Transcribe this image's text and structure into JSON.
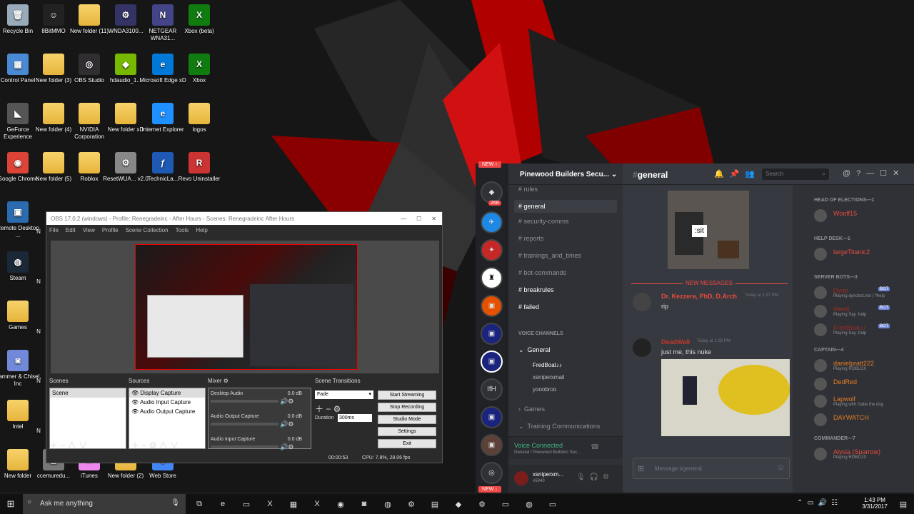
{
  "desktop": {
    "icons": [
      {
        "label": "Recycle Bin",
        "glyph": "🗑",
        "color": "#9ab"
      },
      {
        "label": "8BitMMO",
        "glyph": "☺",
        "color": "#222"
      },
      {
        "label": "New folder (11)",
        "glyph": "",
        "color": "folder"
      },
      {
        "label": "WNDA3100...",
        "glyph": "⚙",
        "color": "#336"
      },
      {
        "label": "NETGEAR WNA31...",
        "glyph": "N",
        "color": "#448"
      },
      {
        "label": "Xbox (beta)",
        "glyph": "X",
        "color": "#107c10"
      },
      {
        "label": "Control Panel",
        "glyph": "▦",
        "color": "#4a8ad4"
      },
      {
        "label": "New folder (3)",
        "glyph": "",
        "color": "folder"
      },
      {
        "label": "OBS Studio",
        "glyph": "◎",
        "color": "#302e31"
      },
      {
        "label": "hdaudio_1...",
        "glyph": "◆",
        "color": "#76b900"
      },
      {
        "label": "Microsoft Edge xD",
        "glyph": "e",
        "color": "#0078d7"
      },
      {
        "label": "Xbox",
        "glyph": "X",
        "color": "#107c10"
      },
      {
        "label": "GeForce Experience",
        "glyph": "◣",
        "color": "#555"
      },
      {
        "label": "New folder (4)",
        "glyph": "",
        "color": "folder"
      },
      {
        "label": "NVIDIA Corporation",
        "glyph": "",
        "color": "folder"
      },
      {
        "label": "New folder xD",
        "glyph": "",
        "color": "folder"
      },
      {
        "label": "Internet Explorer",
        "glyph": "e",
        "color": "#1e90ff"
      },
      {
        "label": "logos",
        "glyph": "",
        "color": "folder"
      },
      {
        "label": "Google Chrome",
        "glyph": "◉",
        "color": "#db4437"
      },
      {
        "label": "New folder (5)",
        "glyph": "",
        "color": "folder"
      },
      {
        "label": "Roblox",
        "glyph": "",
        "color": "folder"
      },
      {
        "label": "ResetWUA... v2.0",
        "glyph": "⚙",
        "color": "#888"
      },
      {
        "label": "TechnicLa...",
        "glyph": "ƒ",
        "color": "#1e5ab4"
      },
      {
        "label": "Revo Uninstaller",
        "glyph": "R",
        "color": "#c33"
      },
      {
        "label": "Remote Desktop ...",
        "glyph": "▣",
        "color": "#2b6cb0"
      },
      {
        "label": "Steam",
        "glyph": "◍",
        "color": "#1b2838"
      },
      {
        "label": "Games",
        "glyph": "",
        "color": "folder"
      },
      {
        "label": "Hammer & Chisel, Inc",
        "glyph": "◙",
        "color": "#7289da"
      },
      {
        "label": "Intel",
        "glyph": "",
        "color": "folder"
      },
      {
        "label": "New folder",
        "glyph": "",
        "color": "folder"
      },
      {
        "label": "ccemuredu...",
        "glyph": "▢",
        "color": "#777"
      },
      {
        "label": "iTunes",
        "glyph": "♫",
        "color": "#e8e"
      },
      {
        "label": "New folder (2)",
        "glyph": "",
        "color": "folder"
      },
      {
        "label": "Web Store",
        "glyph": "◈",
        "color": "#4285f4"
      }
    ],
    "partial_labels": [
      "N",
      "N",
      "N",
      "N",
      "N"
    ]
  },
  "obs": {
    "title": "OBS 17.0.2 (windows) - Profile: Renegradeinc - After Hours - Scenes: Renegradeinc After Hours",
    "menu": [
      "File",
      "Edit",
      "View",
      "Profile",
      "Scene Collection",
      "Tools",
      "Help"
    ],
    "scenes_label": "Scenes",
    "scenes": [
      "Scene"
    ],
    "sources_label": "Sources",
    "sources": [
      "Display Capture",
      "Audio Input Capture",
      "Audio Output Capture"
    ],
    "mixer_label": "Mixer",
    "mixer": [
      {
        "name": "Desktop Audio",
        "db": "0.0 dB"
      },
      {
        "name": "Audio Output Capture",
        "db": "0.0 dB"
      },
      {
        "name": "Audio Input Capture",
        "db": "0.0 dB"
      }
    ],
    "transitions_label": "Scene Transitions",
    "transition": "Fade",
    "duration_label": "Duration",
    "duration": "300ms",
    "buttons": [
      "Start Streaming",
      "Stop Recording",
      "Studio Mode",
      "Settings",
      "Exit"
    ],
    "status_time": "00:00:53",
    "status_cpu": "CPU: 7.8%, 28.06 fps"
  },
  "discord": {
    "new_badge": "NEW ↑",
    "new_badge_bottom": "NEW ↓",
    "mention_count": "268",
    "guild_ifh": "IfH",
    "server_name": "Pinewood Builders Secu...",
    "channels": [
      "rules",
      "general",
      "security-comms",
      "reports",
      "trainings_and_times",
      "bot-commands",
      "breakrules",
      "failed"
    ],
    "voice_header": "VOICE CHANNELS",
    "voice_general": "General",
    "voice_users": [
      "FredBoat♪♪",
      "xsniperxmail",
      "yooobroo"
    ],
    "cat_games": "Games",
    "cat_training": "Training Communications",
    "voice_connected": "Voice Connected",
    "voice_connected_sub": "General / Pinewood Builders Sec...",
    "user_name": "xsniperxm...",
    "user_tag": "#5940",
    "chat_channel": "general",
    "search_placeholder": "Search",
    "sit_text": ":sit",
    "new_messages": "NEW MESSAGES",
    "messages": [
      {
        "author": "Dr. Kezzera, PhD, D.Arch",
        "time": "Today at 1:37 PM",
        "text": "rip",
        "color": "#e74c3c"
      },
      {
        "author": "DeadWa8",
        "time": "Today at 1:38 PM",
        "text": "just me, this nuke",
        "color": "#c0392b"
      }
    ],
    "message_placeholder": "Message #general",
    "members": [
      {
        "cat": "HEAD OF ELECTIONS—1"
      },
      {
        "name": "Wooff15",
        "color": "#e74c3c",
        "sub": ""
      },
      {
        "cat": "HELP DESK—1"
      },
      {
        "name": "largeTitanic2",
        "color": "#e74c3c",
        "sub": ""
      },
      {
        "cat": "SERVER BOTS—3"
      },
      {
        "name": "Dyno",
        "color": "#992d22",
        "sub": "Playing dynobot.net | ?help",
        "bot": "BOT"
      },
      {
        "name": "Mee6",
        "color": "#992d22",
        "sub": "Playing Say ;help",
        "bot": "BOT"
      },
      {
        "name": "FredBoat♪♪",
        "color": "#992d22",
        "sub": "Playing Say ;help",
        "bot": "BOT"
      },
      {
        "cat": "CAPTAIN—4"
      },
      {
        "name": "danielpratt222",
        "color": "#e67e22",
        "sub": "Playing ROBLOX"
      },
      {
        "name": "DedRed",
        "color": "#e67e22",
        "sub": ""
      },
      {
        "name": "Lapwolf",
        "color": "#e67e22",
        "sub": "Playing with Gabe the dog"
      },
      {
        "name": "DAYWATCH",
        "color": "#e67e22",
        "sub": ""
      },
      {
        "cat": "COMMANDER—7"
      },
      {
        "name": "Alysia (Sparrow)",
        "color": "#e74c3c",
        "sub": "Playing ROBLOX"
      }
    ]
  },
  "taskbar": {
    "search_placeholder": "Ask me anything",
    "time": "1:43 PM",
    "date": "3/31/2017"
  }
}
